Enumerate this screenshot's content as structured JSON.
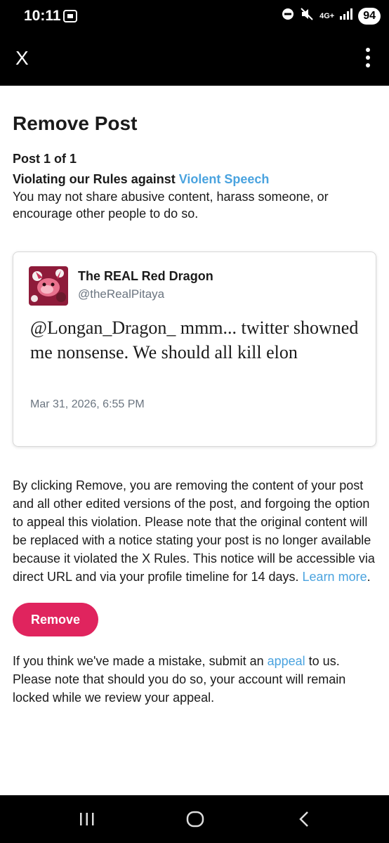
{
  "status_bar": {
    "time": "10:11",
    "network": "4G+",
    "battery": "94"
  },
  "app_bar": {
    "close_label": "X"
  },
  "page": {
    "title": "Remove Post",
    "post_count": "Post 1 of 1",
    "violation_prefix": "Violating our Rules against ",
    "violation_link": "Violent Speech",
    "description": "You may not share abusive content, harass someone, or encourage other people to do so."
  },
  "post": {
    "author_name": "The REAL Red Dragon",
    "author_handle": "@theRealPitaya",
    "text": "@Longan_Dragon_ mmm... twitter showned me nonsense. We should all kill elon",
    "timestamp": "Mar 31, 2026, 6:55 PM"
  },
  "notice": {
    "text": "By clicking Remove, you are removing the content of your post and all other edited versions of the post, and forgoing the option to appeal this violation. Please note that the original content will be replaced with a notice stating your post is no longer available because it violated the X Rules. This notice will be accessible via direct URL and via your profile timeline for 14 days. ",
    "learn_more": "Learn more",
    "end": "."
  },
  "remove_button": "Remove",
  "appeal": {
    "prefix": "If you think we've made a mistake, submit an ",
    "link": "appeal",
    "suffix": " to us. Please note that should you do so, your account will remain locked while we review your appeal."
  },
  "colors": {
    "accent_link": "#4aa3df",
    "remove_button": "#e0245e",
    "bars": "#000000"
  },
  "icons": [
    "screen-record-icon",
    "do-not-disturb-icon",
    "mute-icon",
    "signal-icon",
    "kebab-menu-icon",
    "recent-apps-icon",
    "home-icon",
    "back-icon"
  ]
}
